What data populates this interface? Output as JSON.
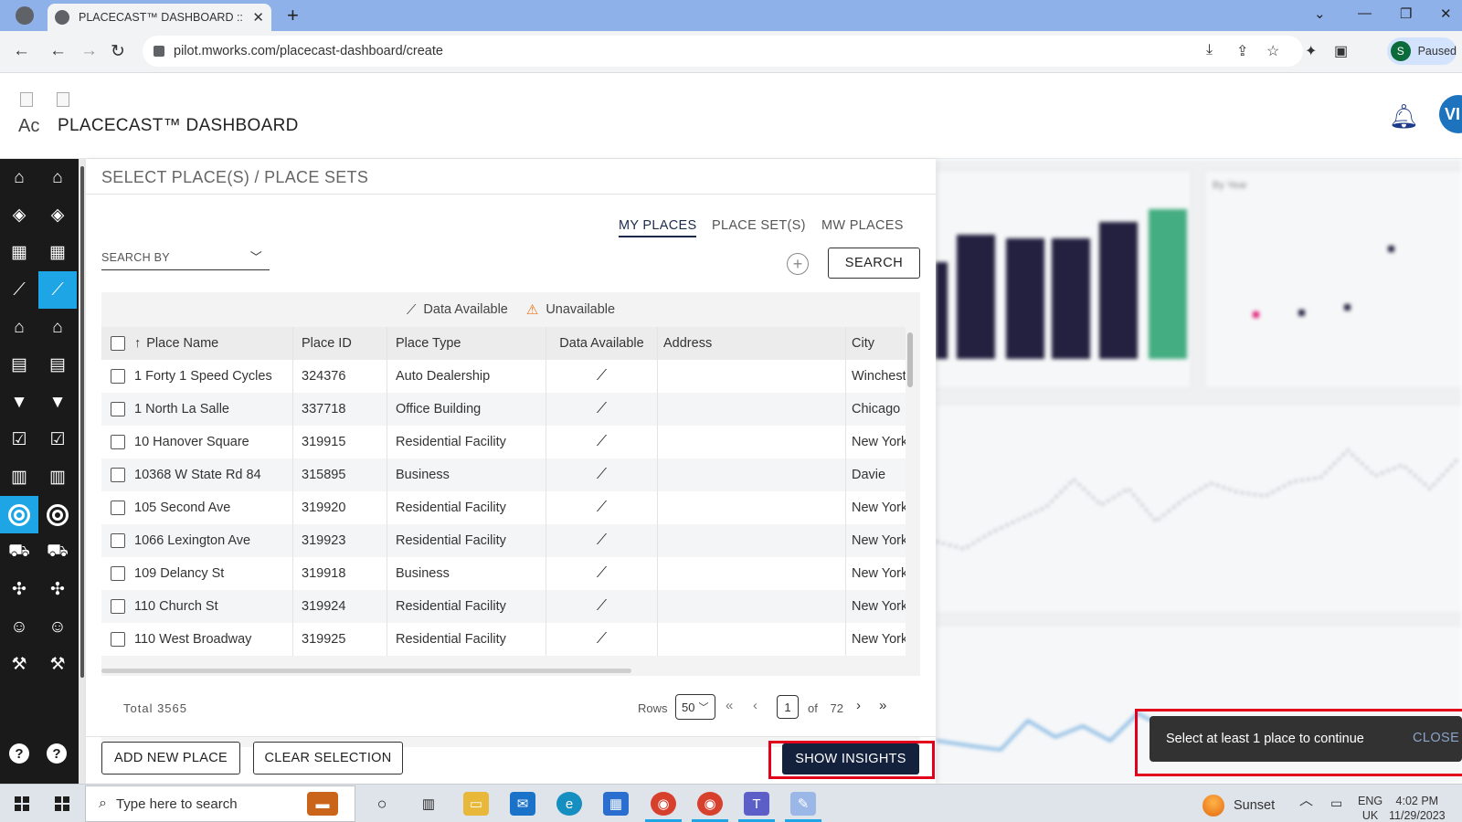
{
  "browser": {
    "tab_title": "PLACECAST™ DASHBOARD :: Mo",
    "url": "pilot.mworks.com/placecast-dashboard/create",
    "profile_initial": "S",
    "profile_status": "Paused"
  },
  "app": {
    "logo_alt": "Ac",
    "title": "PLACECAST™ DASHBOARD",
    "user_initials": "VI"
  },
  "panel": {
    "title": "SELECT PLACE(S) / PLACE SETS",
    "tabs": [
      "MY PLACES",
      "PLACE SET(S)",
      "MW PLACES"
    ],
    "search_by_placeholder": "SEARCH BY",
    "search_button": "SEARCH",
    "legend": {
      "available": "Data Available",
      "unavailable": "Unavailable"
    },
    "columns": [
      "Place Name",
      "Place ID",
      "Place Type",
      "Data Available",
      "Address",
      "City"
    ],
    "rows": [
      {
        "name": "1 Forty 1 Speed Cycles",
        "id": "324376",
        "type": "Auto Dealership",
        "address": "",
        "city": "Winchest"
      },
      {
        "name": "1 North La Salle",
        "id": "337718",
        "type": "Office Building",
        "address": "",
        "city": "Chicago"
      },
      {
        "name": "10 Hanover Square",
        "id": "319915",
        "type": "Residential Facility",
        "address": "",
        "city": "New York"
      },
      {
        "name": "10368 W State Rd 84",
        "id": "315895",
        "type": "Business",
        "address": "",
        "city": "Davie"
      },
      {
        "name": "105 Second Ave",
        "id": "319920",
        "type": "Residential Facility",
        "address": "",
        "city": "New York"
      },
      {
        "name": "1066 Lexington Ave",
        "id": "319923",
        "type": "Residential Facility",
        "address": "",
        "city": "New York"
      },
      {
        "name": "109 Delancy St",
        "id": "319918",
        "type": "Business",
        "address": "",
        "city": "New York"
      },
      {
        "name": "110 Church St",
        "id": "319924",
        "type": "Residential Facility",
        "address": "",
        "city": "New York"
      },
      {
        "name": "110 West Broadway",
        "id": "319925",
        "type": "Residential Facility",
        "address": "",
        "city": "New York"
      }
    ],
    "footer": {
      "total": "Total 3565",
      "rows_label": "Rows",
      "rows_value": "50",
      "page": "1",
      "of_label": "of",
      "page_count": "72"
    },
    "buttons": {
      "add_new_place": "ADD NEW PLACE",
      "clear_selection": "CLEAR SELECTION",
      "show_insights": "SHOW INSIGHTS"
    }
  },
  "background_chart": {
    "label": "By Year"
  },
  "toast": {
    "message": "Select at least 1 place to continue",
    "close": "CLOSE"
  },
  "taskbar": {
    "search_placeholder": "Type here to search",
    "weather": "Sunset",
    "lang_top": "ENG",
    "lang_bottom": "UK",
    "time": "4:02 PM",
    "date": "11/29/2023"
  },
  "colors": {
    "sidebar_bg": "#1a1a1a",
    "sidebar_active": "#1ea5e6",
    "primary_button": "#14213d",
    "highlight_box": "#e3001b",
    "warning": "#e8751a"
  }
}
